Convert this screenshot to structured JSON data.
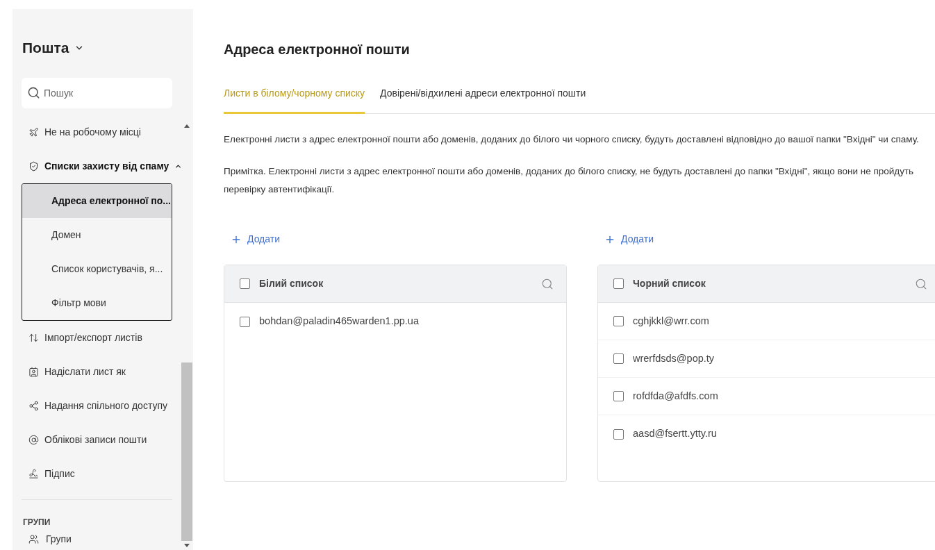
{
  "sidebar": {
    "title": "Пошта",
    "search": {
      "placeholder": "Пошук"
    },
    "items": [
      {
        "label": "Не на робочому місці"
      },
      {
        "label": "Списки захисту від спаму",
        "expanded": true,
        "children": [
          {
            "label": "Адреса електронної по...",
            "selected": true
          },
          {
            "label": "Домен",
            "selected": false
          },
          {
            "label": "Список користувачів, я...",
            "selected": false
          },
          {
            "label": "Фільтр мови",
            "selected": false
          }
        ]
      },
      {
        "label": "Імпорт/експорт листів"
      },
      {
        "label": "Надіслати лист як"
      },
      {
        "label": "Надання спільного доступу"
      },
      {
        "label": "Облікові записи пошти"
      },
      {
        "label": "Підпис"
      }
    ],
    "section": "ГРУПИ",
    "section_items": [
      {
        "label": "Групи"
      }
    ]
  },
  "page": {
    "title": "Адреса електронної пошти",
    "tabs": [
      {
        "label": "Листи в білому/чорному списку",
        "selected": true
      },
      {
        "label": "Довірені/відхилені адреси електронної пошти",
        "selected": false
      }
    ],
    "description": "Електронні листи з адрес електронної пошти або доменів, доданих до білого чи чорного списку, будуть доставлені відповідно до вашої папки \"Вхідні\" чи спаму.",
    "note": "Примітка. Електронні листи з адрес електронної пошти або доменів, доданих до білого списку, не будуть доставлені до папки \"Вхідні\", якщо вони не пройдуть перевірку автентифікації.",
    "lists": [
      {
        "add": "Додати",
        "title": "Білий список",
        "checked": false,
        "rows": [
          {
            "address": "bohdan@paladin465warden1.pp.ua",
            "checked": false
          }
        ]
      },
      {
        "add": "Додати",
        "title": "Чорний список",
        "checked": false,
        "rows": [
          {
            "address": "cghjkkl@wrr.com",
            "checked": false
          },
          {
            "address": "wrerfdsds@pop.ty",
            "checked": false
          },
          {
            "address": "rofdfda@afdfs.com",
            "checked": false
          },
          {
            "address": "aasd@fsertt.ytty.ru",
            "checked": false
          }
        ]
      }
    ]
  }
}
